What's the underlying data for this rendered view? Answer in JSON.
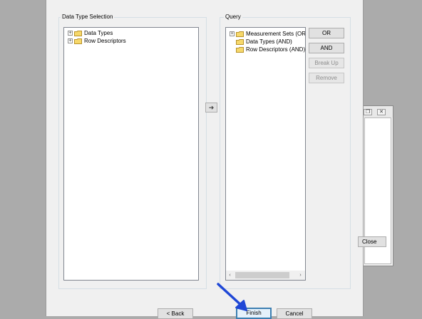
{
  "background_window": {
    "close_label": "Close",
    "restore_glyph": "❐",
    "close_glyph": "✕"
  },
  "dialog": {
    "data_type_selection": {
      "title": "Data Type Selection",
      "items": [
        {
          "label": "Data Types",
          "expander": "+"
        },
        {
          "label": "Row Descriptors",
          "expander": "+"
        }
      ]
    },
    "move_arrow": "➜",
    "query": {
      "title": "Query",
      "items": [
        {
          "label": "Measurement Sets (OR)",
          "expander": "+"
        },
        {
          "label": "Data Types (AND)",
          "expander": ""
        },
        {
          "label": "Row Descriptors (AND)",
          "expander": ""
        }
      ],
      "buttons": {
        "or": "OR",
        "and": "AND",
        "break_up": "Break Up",
        "remove": "Remove"
      },
      "scroll_left": "‹",
      "scroll_right": "›"
    },
    "footer": {
      "back": "< Back",
      "finish": "Finish",
      "cancel": "Cancel"
    }
  },
  "annotation_arrow_color": "#1f47d6"
}
